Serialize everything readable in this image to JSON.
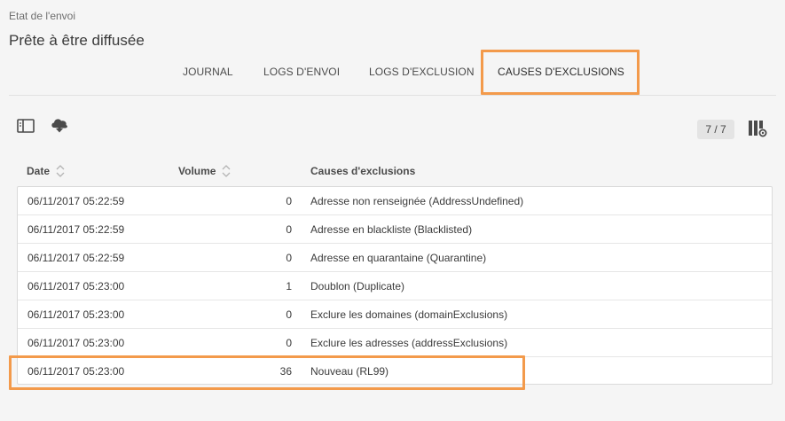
{
  "header": {
    "breadcrumb": "Etat de l'envoi",
    "title": "Prête à être diffusée"
  },
  "tabs": [
    {
      "label": "JOURNAL",
      "active": false
    },
    {
      "label": "LOGS D'ENVOI",
      "active": false
    },
    {
      "label": "LOGS D'EXCLUSION",
      "active": false
    },
    {
      "label": "CAUSES D'EXCLUSIONS",
      "active": true
    }
  ],
  "toolbar": {
    "left_icons": [
      "panel-toggle-icon",
      "cloud-download-icon"
    ],
    "count": "7 / 7",
    "right_icon": "column-settings-icon"
  },
  "table": {
    "columns": [
      {
        "label": "Date",
        "sortable": true
      },
      {
        "label": "Volume",
        "sortable": true
      },
      {
        "label": "Causes d'exclusions",
        "sortable": false
      }
    ],
    "rows": [
      {
        "date": "06/11/2017 05:22:59",
        "volume": "0",
        "cause": "Adresse non renseignée (AddressUndefined)"
      },
      {
        "date": "06/11/2017 05:22:59",
        "volume": "0",
        "cause": "Adresse en blackliste (Blacklisted)"
      },
      {
        "date": "06/11/2017 05:22:59",
        "volume": "0",
        "cause": "Adresse en quarantaine (Quarantine)"
      },
      {
        "date": "06/11/2017 05:23:00",
        "volume": "1",
        "cause": "Doublon (Duplicate)"
      },
      {
        "date": "06/11/2017 05:23:00",
        "volume": "0",
        "cause": "Exclure les domaines (domainExclusions)"
      },
      {
        "date": "06/11/2017 05:23:00",
        "volume": "0",
        "cause": "Exclure les adresses (addressExclusions)"
      },
      {
        "date": "06/11/2017 05:23:00",
        "volume": "36",
        "cause": "Nouveau (RL99)"
      }
    ]
  },
  "colors": {
    "highlight": "#f39a4b",
    "background": "#f5f5f5",
    "table_bg": "#ffffff"
  }
}
